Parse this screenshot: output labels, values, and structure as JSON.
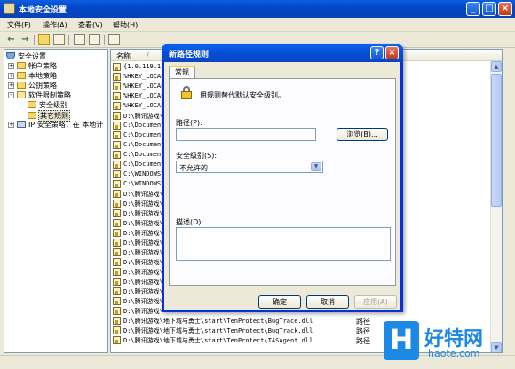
{
  "window": {
    "title": "本地安全设置",
    "minimize": "_",
    "maximize": "□",
    "close": "×"
  },
  "menu": [
    "文件(F)",
    "操作(A)",
    "查看(V)",
    "帮助(H)"
  ],
  "toolbar": {
    "back": "←",
    "forward": "→"
  },
  "tree": {
    "root": "安全设置",
    "items": [
      {
        "label": "帐户策略",
        "expander": "+"
      },
      {
        "label": "本地策略",
        "expander": "+"
      },
      {
        "label": "公钥策略",
        "expander": "+"
      },
      {
        "label": "软件限制策略",
        "expander": "-"
      },
      {
        "label": "安全级别",
        "expander": ""
      },
      {
        "label": "其它规则",
        "expander": ""
      },
      {
        "label": "IP 安全策略，在 本地计",
        "expander": "+"
      }
    ]
  },
  "list": {
    "columns": {
      "name": "名称",
      "sort_arrow": "/",
      "type": ""
    },
    "rows": [
      {
        "name": "{1.0.119.1",
        "type": ""
      },
      {
        "name": "%HKEY_LOCAL",
        "type": ""
      },
      {
        "name": "%HKEY_LOCAL",
        "type": ""
      },
      {
        "name": "%HKEY_LOCAL",
        "type": ""
      },
      {
        "name": "%HKEY_LOCAL",
        "type": ""
      },
      {
        "name": "D:\\腾讯游戏\\",
        "type": ""
      },
      {
        "name": "C:\\Document",
        "type": ""
      },
      {
        "name": "C:\\Document",
        "type": ""
      },
      {
        "name": "C:\\Document",
        "type": ""
      },
      {
        "name": "C:\\Document",
        "type": ""
      },
      {
        "name": "C:\\Document",
        "type": ""
      },
      {
        "name": "C:\\WINDOWS\\",
        "type": ""
      },
      {
        "name": "C:\\WINDOWS\\",
        "type": ""
      },
      {
        "name": "D:\\腾讯游戏\\",
        "type": ""
      },
      {
        "name": "D:\\腾讯游戏\\",
        "type": ""
      },
      {
        "name": "D:\\腾讯游戏\\",
        "type": ""
      },
      {
        "name": "D:\\腾讯游戏\\",
        "type": ""
      },
      {
        "name": "D:\\腾讯游戏\\",
        "type": ""
      },
      {
        "name": "D:\\腾讯游戏\\",
        "type": ""
      },
      {
        "name": "D:\\腾讯游戏\\",
        "type": ""
      },
      {
        "name": "D:\\腾讯游戏\\",
        "type": ""
      },
      {
        "name": "D:\\腾讯游戏\\",
        "type": ""
      },
      {
        "name": "D:\\腾讯游戏\\",
        "type": ""
      },
      {
        "name": "D:\\腾讯游戏\\",
        "type": ""
      },
      {
        "name": "D:\\腾讯游戏\\",
        "type": ""
      },
      {
        "name": "D:\\腾讯游戏\\",
        "type": ""
      },
      {
        "name": "D:\\腾讯游戏\\地下城与勇士\\start\\TenProtect\\BugTrace.dll",
        "type": "路径"
      },
      {
        "name": "D:\\腾讯游戏\\地下城与勇士\\start\\TenProtect\\BugTrack.dll",
        "type": "路径"
      },
      {
        "name": "D:\\腾讯游戏\\地下城与勇士\\start\\TenProtect\\TASAgent.dll",
        "type": "路径"
      }
    ]
  },
  "dialog": {
    "title": "新路径规则",
    "help": "?",
    "close": "×",
    "tab": "常规",
    "description": "用规则替代默认安全级别。",
    "path_label": "路径(P):",
    "path_value": "",
    "browse": "浏览(B)...",
    "level_label": "安全级别(S):",
    "level_value": "不允许的",
    "combo_arrow": "▼",
    "desc_label": "描述(D):",
    "desc_value": "",
    "ok": "确定",
    "cancel": "取消",
    "apply": "应用(A)"
  },
  "watermark": {
    "logo": "H",
    "name": "好特网",
    "domain": "haote.com"
  }
}
